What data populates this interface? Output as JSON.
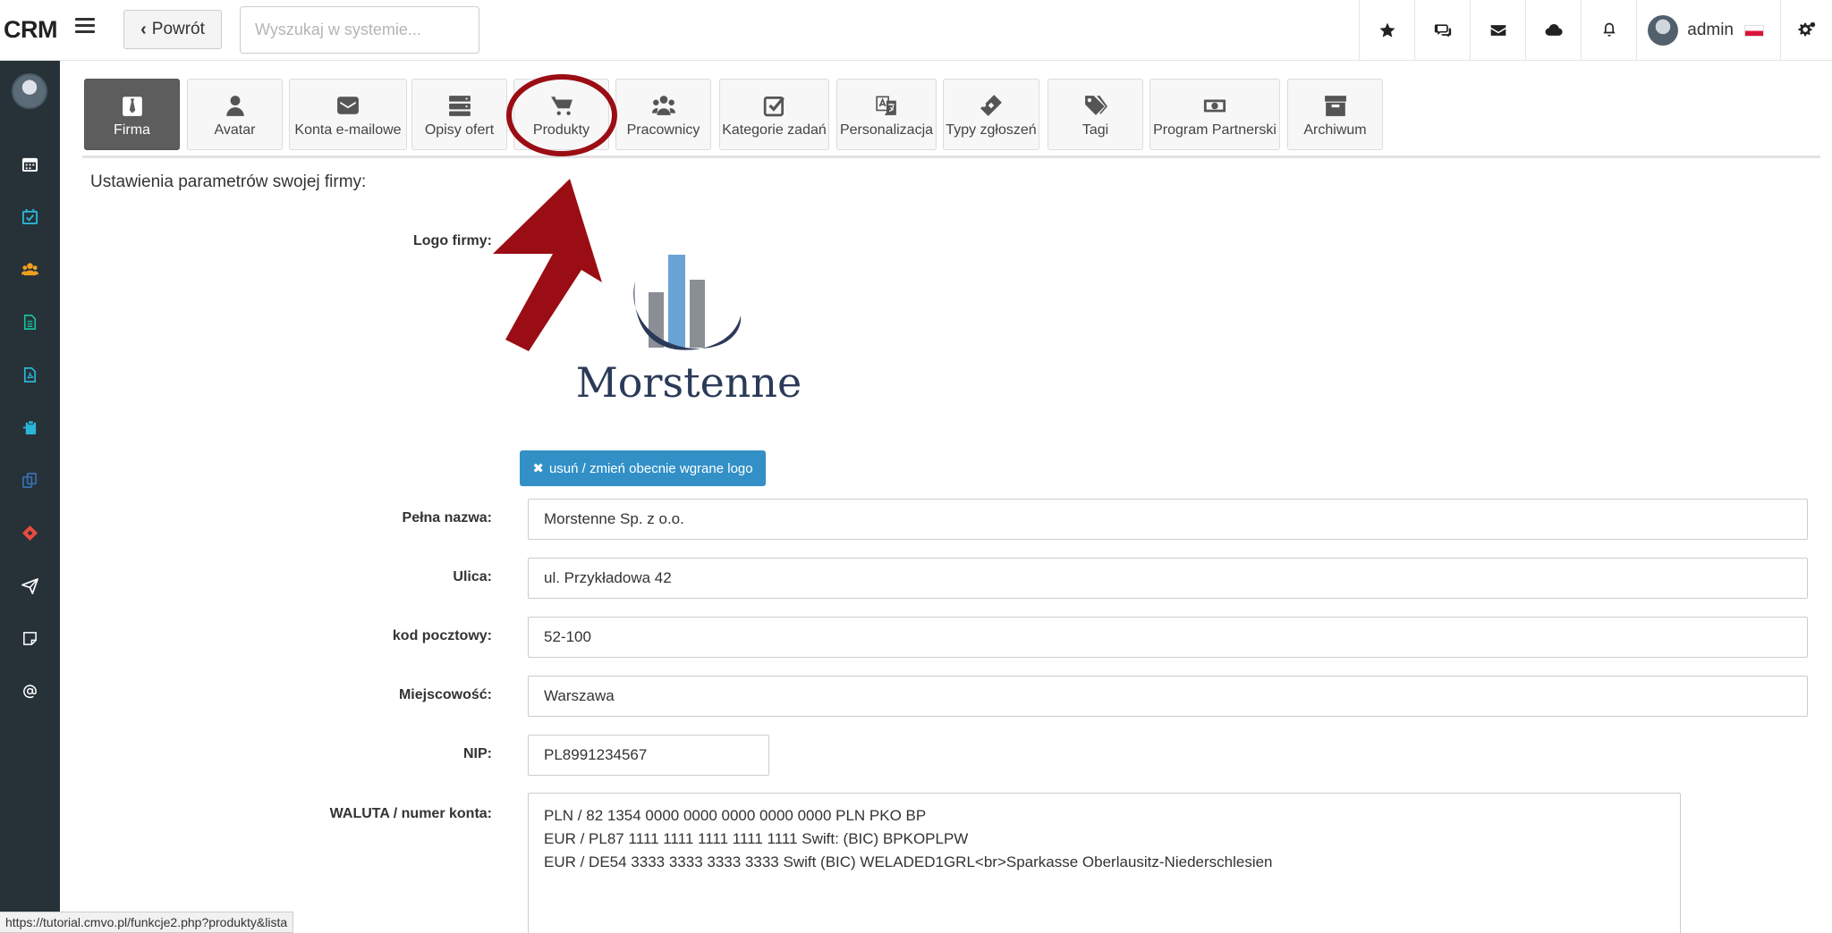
{
  "app": {
    "brand": "CRM"
  },
  "toolbar": {
    "back_label": "Powrót",
    "search_placeholder": "Wyszukaj w systemie...",
    "user_name": "admin"
  },
  "top_icons": [
    "star-icon",
    "chat-icon",
    "envelope-icon",
    "cloud-icon",
    "bell-icon"
  ],
  "sidebar": {
    "items": [
      {
        "icon": "calendar-icon",
        "color": "#ffffff"
      },
      {
        "icon": "calendar-check-icon",
        "color": "#2bb5d8"
      },
      {
        "icon": "users-icon",
        "color": "#f0a020"
      },
      {
        "icon": "document-icon",
        "color": "#1abc9c"
      },
      {
        "icon": "pdf-icon",
        "color": "#2bb5d8"
      },
      {
        "icon": "clipboard-icon",
        "color": "#2bb5d8"
      },
      {
        "icon": "copy-icon",
        "color": "#3a6fb0"
      },
      {
        "icon": "ticket-icon",
        "color": "#e74c3c"
      },
      {
        "icon": "send-icon",
        "color": "#ffffff"
      },
      {
        "icon": "note-icon",
        "color": "#ffffff"
      },
      {
        "icon": "at-icon",
        "color": "#ffffff"
      }
    ]
  },
  "tabs": [
    {
      "label": "Firma",
      "icon": "tie-icon",
      "active": true
    },
    {
      "label": "Avatar",
      "icon": "user-icon"
    },
    {
      "label": "Konta e-mailowe",
      "icon": "envelope-icon"
    },
    {
      "label": "Opisy ofert",
      "icon": "server-icon"
    },
    {
      "label": "Produkty",
      "icon": "cart-icon"
    },
    {
      "label": "Pracownicy",
      "icon": "users-icon"
    },
    {
      "label": "Kategorie zadań",
      "icon": "checkbox-icon"
    },
    {
      "label": "Personalizacja",
      "icon": "translate-icon"
    },
    {
      "label": "Typy zgłoszeń",
      "icon": "ticket-icon"
    },
    {
      "label": "Tagi",
      "icon": "tags-icon"
    },
    {
      "label": "Program Partnerski",
      "icon": "money-icon"
    },
    {
      "label": "Archiwum",
      "icon": "archive-icon"
    }
  ],
  "content": {
    "title": "Ustawienia parametrów swojej firmy:",
    "logo_label": "Logo firmy:",
    "logo_text": "Morstenne",
    "logo_button": "usuń / zmień obecnie wgrane logo",
    "fields": {
      "full_name": {
        "label": "Pełna nazwa:",
        "value": "Morstenne Sp. z o.o."
      },
      "street": {
        "label": "Ulica:",
        "value": "ul. Przykładowa 42"
      },
      "postal_code": {
        "label": "kod pocztowy:",
        "value": "52-100"
      },
      "city": {
        "label": "Miejscowość:",
        "value": "Warszawa"
      },
      "nip": {
        "label": "NIP:",
        "value": "PL8991234567"
      },
      "currency": {
        "label": "WALUTA / numer konta:",
        "lines": [
          "PLN / 82 1354 0000 0000 0000 0000 0000 PLN PKO BP",
          "EUR / PL87 1111 1111 1111 1111 1111 Swift: (BIC) BPKOPLPW",
          "EUR / DE54 3333 3333 3333 3333 Swift (BIC) WELADED1GRL<br>Sparkasse Oberlausitz-Niederschlesien"
        ]
      }
    }
  },
  "status_bar": {
    "url": "https://tutorial.cmvo.pl/funkcje2.php?produkty&lista"
  },
  "colors": {
    "sidebar": "#263238",
    "active_tab": "#5d5d5d",
    "primary_button": "#3290c7",
    "annotation": "#9b0d14"
  }
}
